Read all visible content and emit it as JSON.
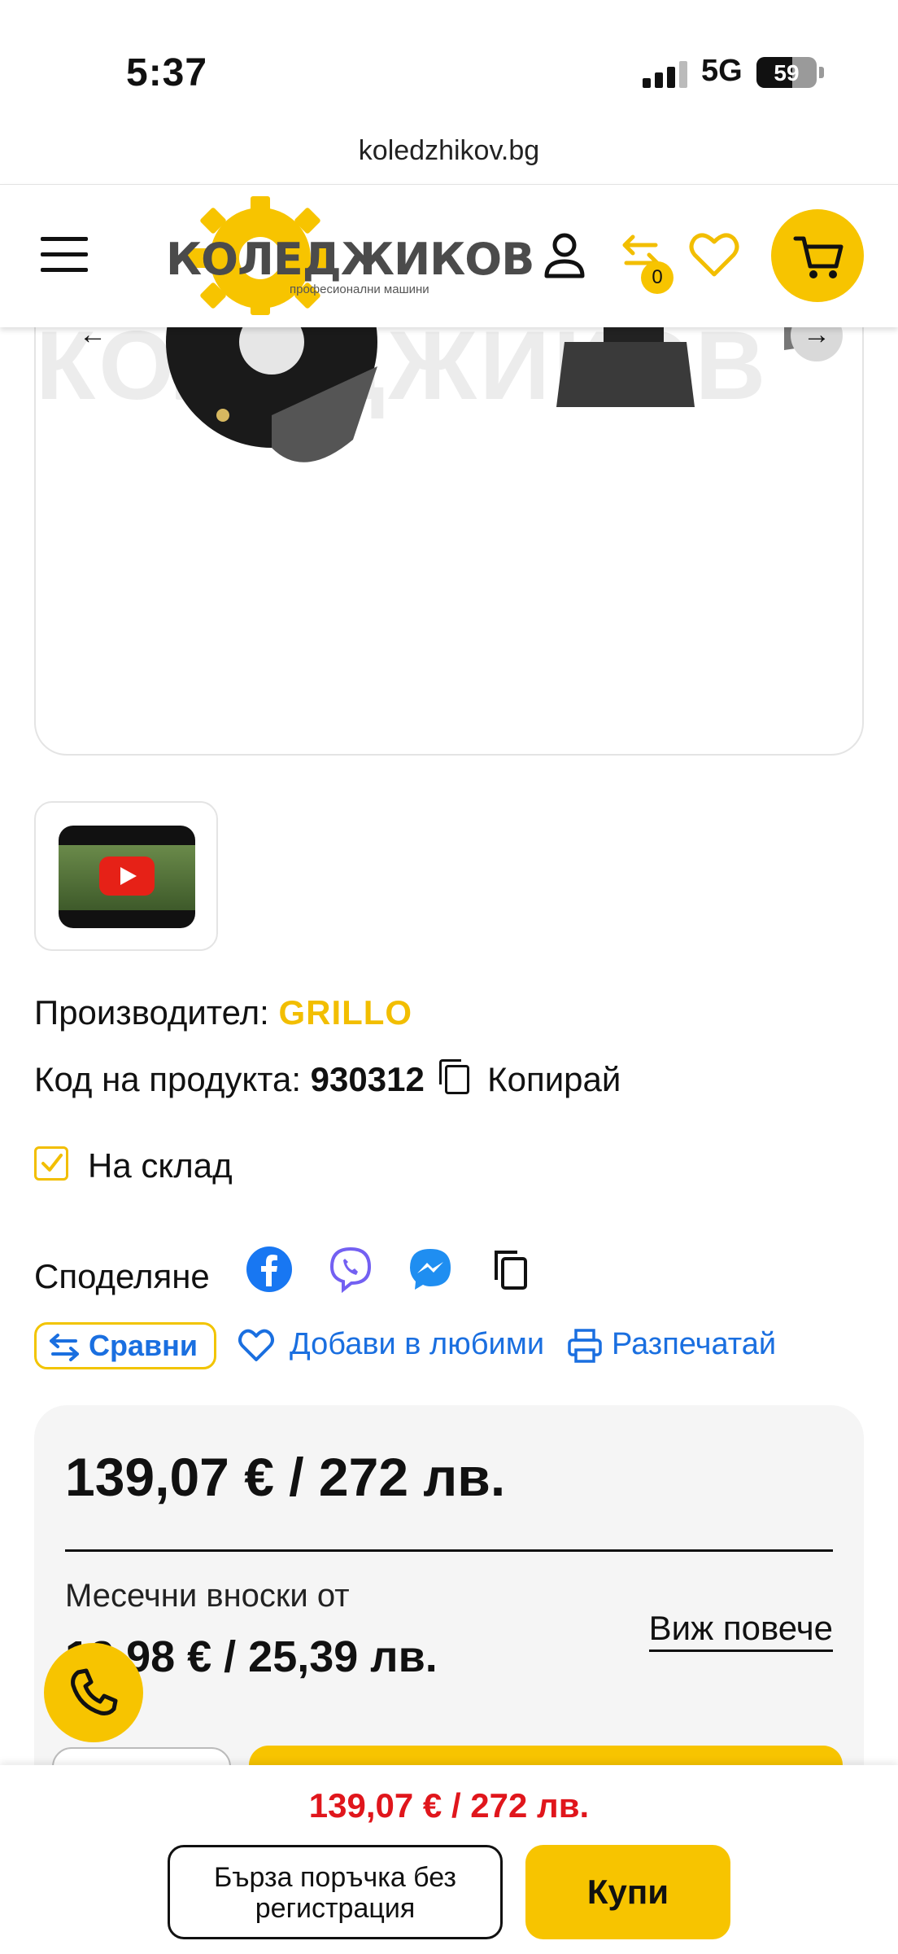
{
  "status_bar": {
    "time": "5:37",
    "network": "5G",
    "battery": "59"
  },
  "browser": {
    "url": "koledzhikov.bg"
  },
  "header": {
    "logo_text": "КОЛЕДЖИКОВ",
    "logo_sub": "професионални машини",
    "compare_count": "0",
    "icons": {
      "menu": "menu-icon",
      "user": "user-icon",
      "compare": "compare-icon",
      "wishlist": "heart-icon",
      "cart": "cart-icon"
    }
  },
  "gallery": {
    "watermark": "КОЛЕДЖИКОВ",
    "prev": "←",
    "next": "→"
  },
  "product": {
    "manufacturer_label": "Производител:",
    "manufacturer_value": "GRILLO",
    "code_label": "Код на продукта:",
    "code_value": "930312",
    "copy_label": "Копирай",
    "stock_label": "На склад"
  },
  "share": {
    "label": "Споделяне",
    "icons": [
      "facebook-icon",
      "viber-icon",
      "messenger-icon",
      "copy-icon"
    ]
  },
  "actions": {
    "compare": "Сравни",
    "wishlist": "Добави в любими",
    "print": "Разпечатай"
  },
  "pricing": {
    "price": "139,07 € / 272 лв.",
    "monthly_label": "Месечни вноски от",
    "monthly_value": "12,98 € / 25,39 лв.",
    "see_more": "Виж повече"
  },
  "bottom_bar": {
    "price": "139,07 € / 272 лв.",
    "quick_order_line1": "Бърза поръчка без",
    "quick_order_line2": "регистрация",
    "buy": "Купи"
  },
  "colors": {
    "accent": "#f7c400",
    "link": "#1a6fe0",
    "price_red": "#e0161c"
  }
}
